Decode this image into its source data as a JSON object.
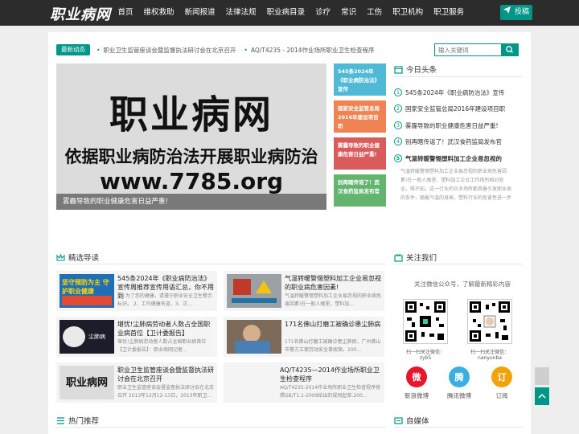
{
  "header": {
    "logo": "职业病网",
    "menu": [
      "首页",
      "维权救助",
      "新闻报道",
      "法律法规",
      "职业病目录",
      "诊疗",
      "常识",
      "工伤",
      "职卫机构",
      "职卫服务"
    ],
    "submit_label": "投稿"
  },
  "newsbar": {
    "tag": "最新动态",
    "items": [
      "职业卫生监管座谈会暨监督执法研讨会在北京召开",
      "AQ/T4235 - 2014作业场所职业卫生检查程序"
    ]
  },
  "search": {
    "placeholder": "输入关键词"
  },
  "slider": {
    "line1": "职业病网",
    "line2": "依据职业病防治法开展职业病防治",
    "line3": "www.7785.org",
    "caption": "雾霾导致的职业健康危害日益严重!"
  },
  "tiles": [
    {
      "text": "545条2024年《职业病防治法》宣传",
      "color": "#4fb9d6"
    },
    {
      "text": "国家安全监管总局2016年建设项目职",
      "color": "#ef8354"
    },
    {
      "text": "雾霾导致的职业健康危害日益严重!",
      "color": "#d95b5b"
    },
    {
      "text": "别再瞎传谣了！武汉食药监局发布官",
      "color": "#62b46f"
    }
  ],
  "headlines": {
    "title": "今日头条",
    "items": [
      "545条2024年《职业病防治法》宣传",
      "国家安全监管总局2016年建设项目职",
      "雾霾导致的职业健康危害日益严重!",
      "别再瞎传谣了！武汉食药监局发布官",
      "气温转暖警惕塑料加工企业易忽视的"
    ],
    "desc": "气温转暖警惕塑料加工企业易忽视的职业病危害因素!在一般人眼里，塑料加工企业工作场所相对安全，殊不知，这一行业的众多场所都具备引发职业病的条件，随着气温的身高，塑料行业的危害性进一步"
  },
  "featured": {
    "title": "精选导读",
    "cards": [
      {
        "title": "545条2024年《职业病防治法》宣传周推荐宣传用语汇总，你不用到",
        "desc": "1、为了您的健康，请遵守职业安全卫生警示标识。 2、工作健康有道，3、正...",
        "thumb_text": "坚守预防为主 守护职业健康"
      },
      {
        "title": "气温转暖警惕塑料加工企业易忽视的职业病危害因素!",
        "desc": "气温转暖警惕塑料加工企业易忽视的职业病危害因素!在一般人眼里，塑料加...",
        "thumb_text": ""
      },
      {
        "title": "堪忧!尘肺病劳动者人数占全国职业病首位【卫计委报告】",
        "desc": "堪忧!尘肺病劳动者人数占全国职业病首位【卫计委报告】：职业病网记者...",
        "thumb_text": "尘肺病"
      },
      {
        "title": "171名佛山打磨工被确诊患尘肺病",
        "desc": "171名佛山打磨工被确诊患尘肺病，广州佛山市警方立案劳动安全事故案。200...",
        "thumb_text": ""
      },
      {
        "title": "职业卫生监管座谈会暨监督执法研讨会在北京召开",
        "desc": "职业卫生监管座谈会暨监督执法研讨会在北京召开 2013年12月12-13日，2013年职卫...",
        "thumb_text": "职业病网"
      },
      {
        "title": "AQ/T4235—2014作业场所职业卫生检查程序",
        "desc": "AQ/T4235-2014作业场所职业卫生检查程序按照GB/T1.1-2009给出的规则起草.200...",
        "thumb_text": ""
      }
    ]
  },
  "follow": {
    "title": "关注我们",
    "text": "关注微信公众号，了解最新精彩内容",
    "qr_labels": [
      "扫一扫关注微信：zyb5",
      "扫一扫关注微信：nanyunba"
    ],
    "social": [
      {
        "label": "新浪微博",
        "color": "#e6162d",
        "glyph": "微"
      },
      {
        "label": "腾讯微博",
        "color": "#3ab0e2",
        "glyph": "腾"
      },
      {
        "label": "订阅",
        "color": "#f0a30a",
        "glyph": "订"
      }
    ]
  },
  "hot": {
    "title": "热门推荐"
  },
  "media": {
    "title": "自媒体"
  },
  "colors": {
    "accent": "#009688",
    "nav": "#2c2c2c",
    "background": "#eeeeee"
  }
}
